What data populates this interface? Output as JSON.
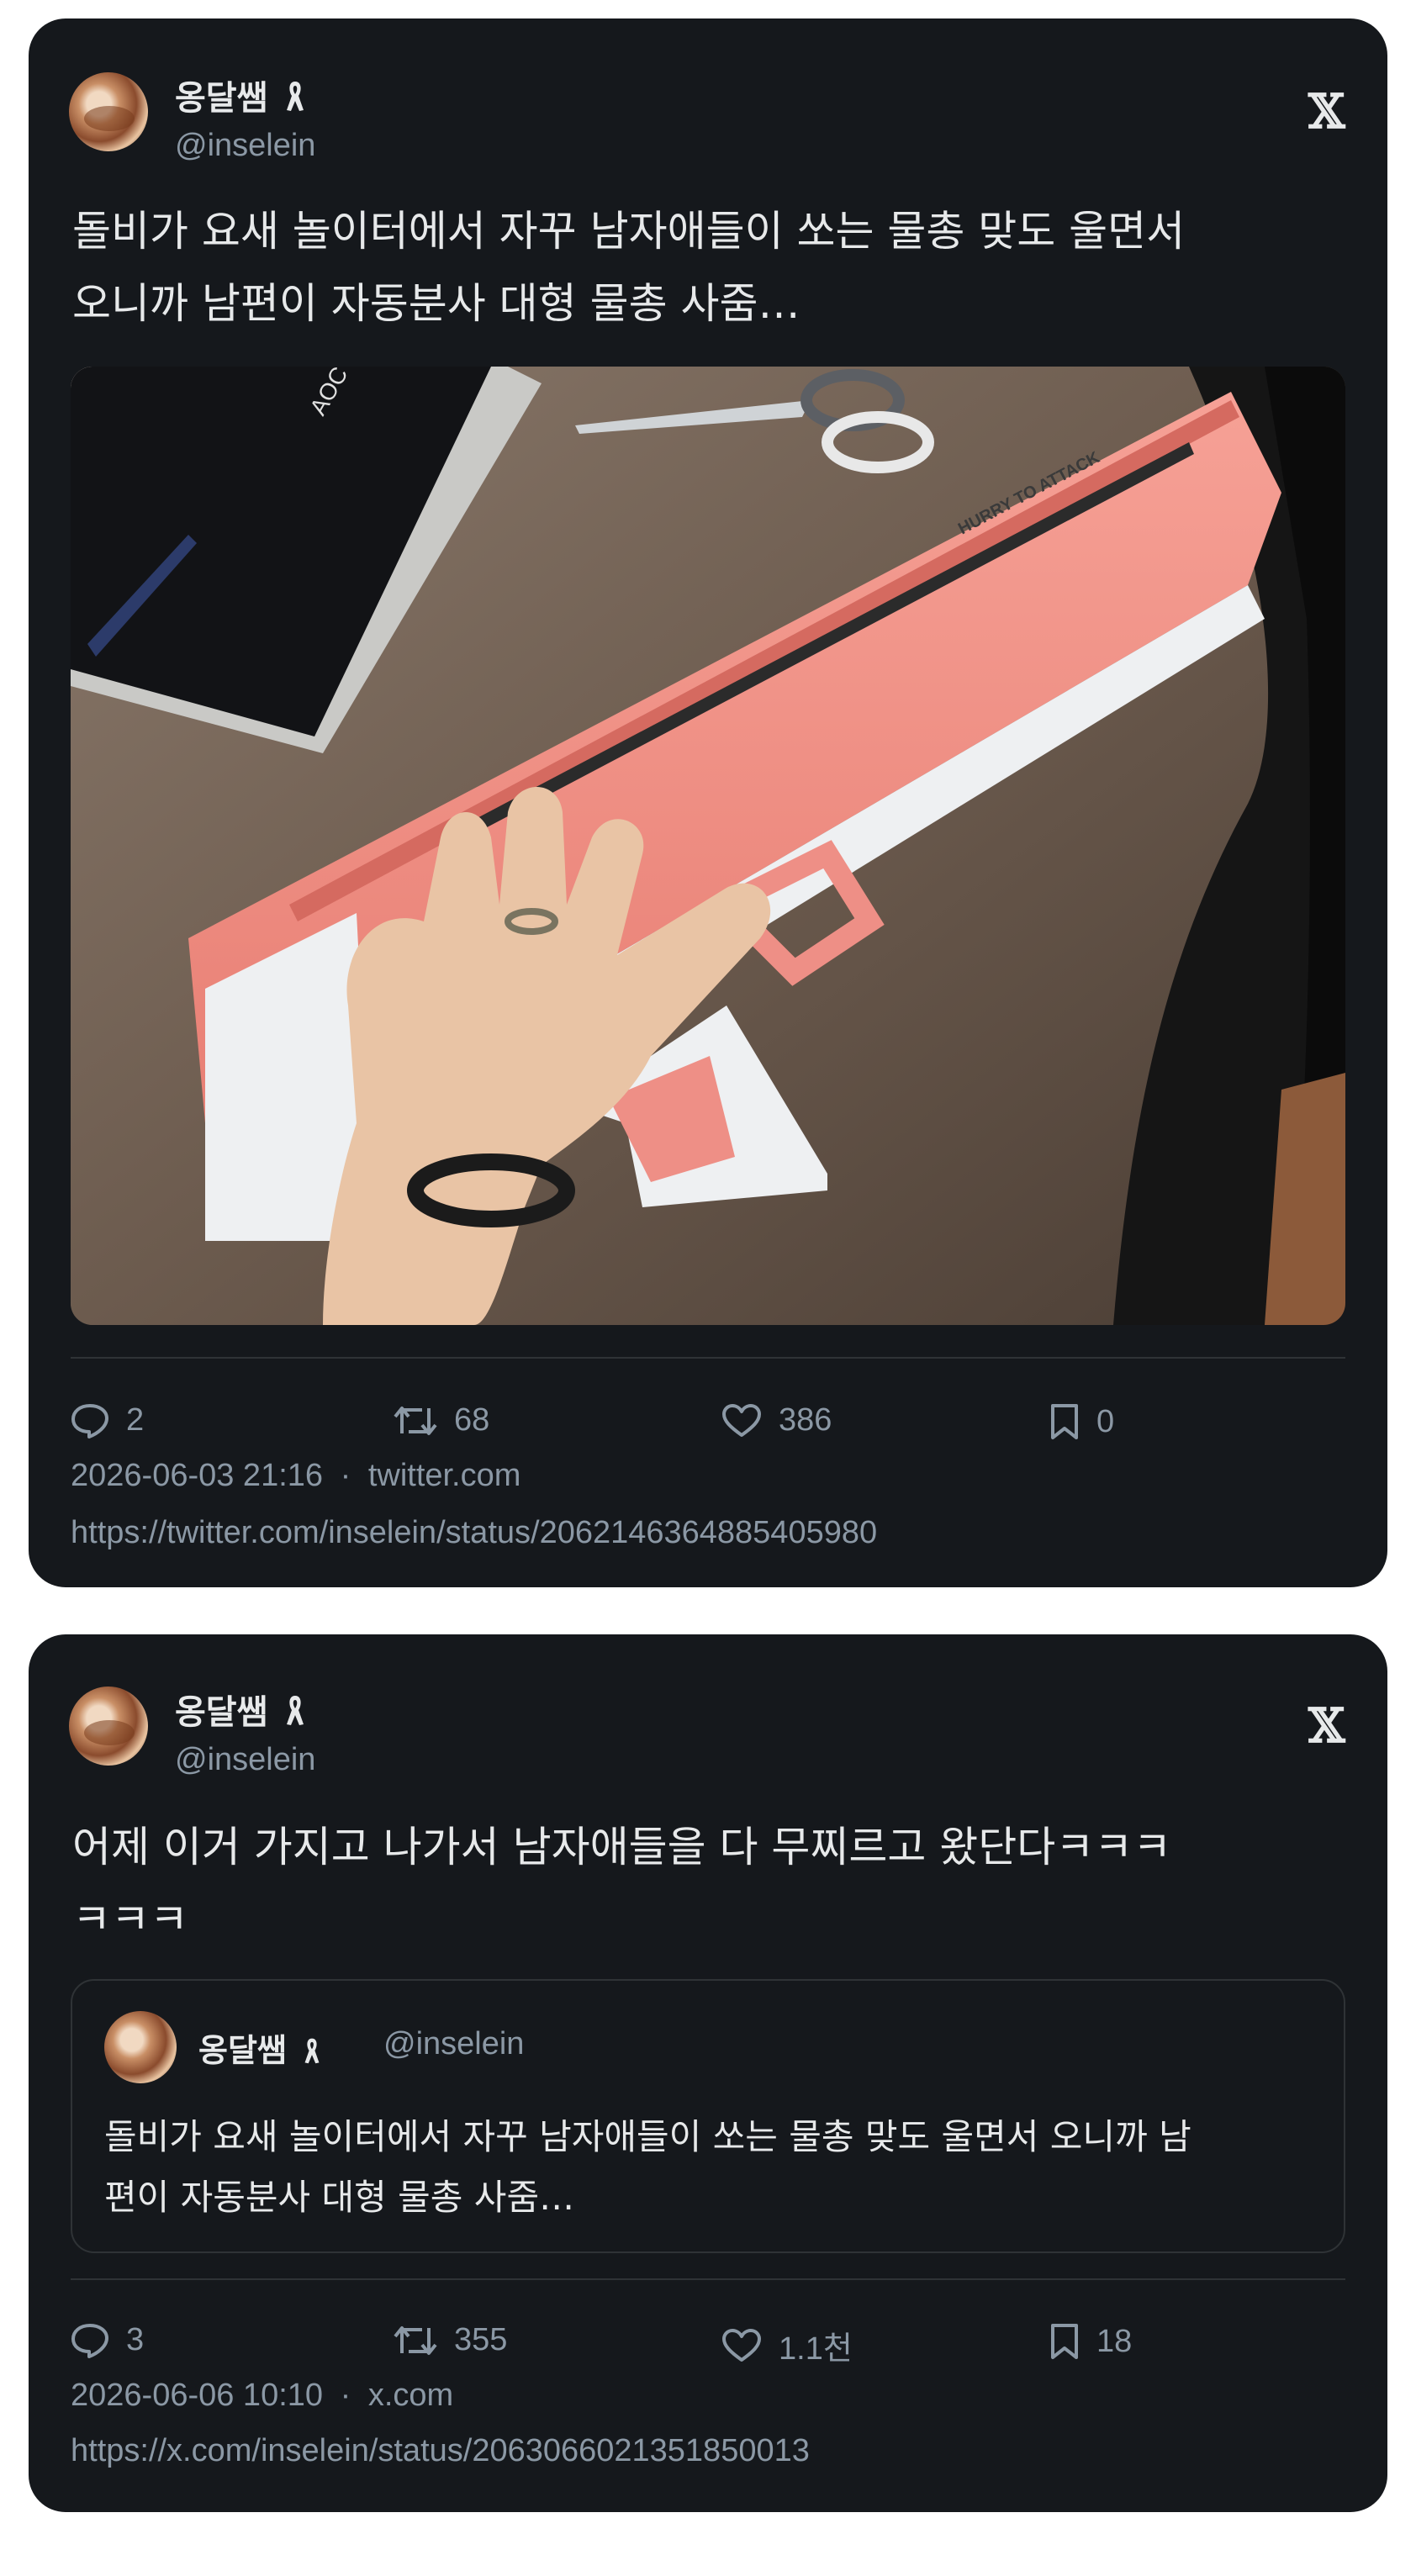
{
  "tweet1": {
    "name": "옹달쌤",
    "handle": "@inselein",
    "platform_logo": "𝕏",
    "text_line1": "돌비가 요새 놀이터에서 자꾸 남자애들이 쏘는 물총 맞도 울면서",
    "text_line2": "오니까 남편이 자동분사 대형 물총 사줌…",
    "image_caption": "HURRY TO ATTACK",
    "image_logo": "AOC",
    "replies": "2",
    "retweets": "68",
    "likes": "386",
    "bookmarks": "0",
    "datetime": "2026-06-03 21:16",
    "separator": "·",
    "source": "twitter.com",
    "url": "https://twitter.com/inselein/status/2062146364885405980"
  },
  "tweet2": {
    "name": "옹달쌤",
    "handle": "@inselein",
    "platform_logo": "𝕏",
    "text_line1": "어제 이거 가지고 나가서 남자애들을 다 무찌르고 왔단다ㅋㅋㅋ",
    "text_line2": "ㅋㅋㅋ",
    "quote": {
      "name": "옹달쌤",
      "handle": "@inselein",
      "text_line1": "돌비가 요새 놀이터에서 자꾸 남자애들이 쏘는 물총 맞도 울면서 오니까 남",
      "text_line2": "편이 자동분사 대형 물총 사줌…"
    },
    "replies": "3",
    "retweets": "355",
    "likes": "1.1천",
    "bookmarks": "18",
    "datetime": "2026-06-06 10:10",
    "separator": "·",
    "source": "x.com",
    "url": "https://x.com/inselein/status/2063066021351850013"
  },
  "colors": {
    "card_bg": "#15181c",
    "text_primary": "#e7e9ea",
    "text_secondary": "#8b98a5",
    "divider": "#2f3336",
    "gun_pink": "#f08a80",
    "gun_white": "#eceff1"
  },
  "icons": [
    "reply-icon",
    "retweet-icon",
    "like-icon",
    "bookmark-icon",
    "x-logo-icon",
    "ribbon-icon"
  ]
}
